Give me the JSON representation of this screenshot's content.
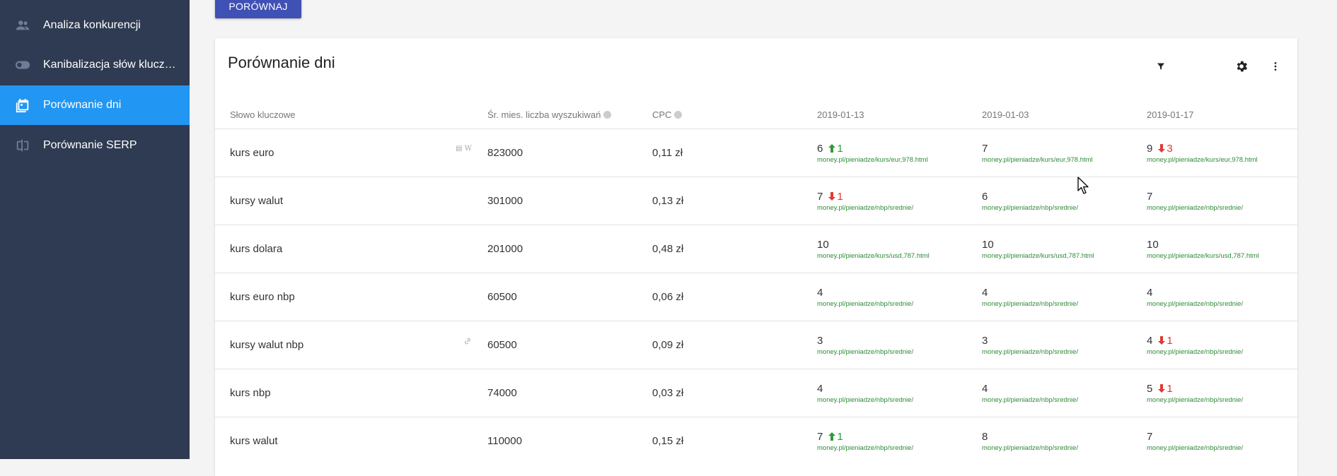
{
  "sidebar": {
    "items": [
      {
        "label": "Analiza konkurencji",
        "icon": "people-icon",
        "active": false
      },
      {
        "label": "Kanibalizacja słów klucz…",
        "icon": "toggle-icon",
        "active": false
      },
      {
        "label": "Porównanie dni",
        "icon": "calendar-compare-icon",
        "active": true
      },
      {
        "label": "Porównanie SERP",
        "icon": "compare-icon",
        "active": false
      }
    ]
  },
  "toolbar": {
    "compare_label": "PORÓWNAJ"
  },
  "card": {
    "title": "Porównanie dni",
    "headers": {
      "keyword": "Słowo kluczowe",
      "volume": "Śr. mies. liczba wyszukiwań",
      "cpc": "CPC",
      "date1": "2019-01-13",
      "date2": "2019-01-03",
      "date3": "2019-01-17"
    },
    "rows": [
      {
        "keyword": "kurs euro",
        "extra": "serp-features-icon",
        "volume": "823000",
        "cpc": "0,11 zł",
        "d1": {
          "pos": "6",
          "chg": "1",
          "dir": "up",
          "url": "money.pl/pieniadze/kurs/eur,978.html"
        },
        "d2": {
          "pos": "7",
          "chg": "",
          "dir": "",
          "url": "money.pl/pieniadze/kurs/eur,978.html"
        },
        "d3": {
          "pos": "9",
          "chg": "3",
          "dir": "down",
          "url": "money.pl/pieniadze/kurs/eur,978.html"
        }
      },
      {
        "keyword": "kursy walut",
        "extra": "",
        "volume": "301000",
        "cpc": "0,13 zł",
        "d1": {
          "pos": "7",
          "chg": "1",
          "dir": "down",
          "url": "money.pl/pieniadze/nbp/srednie/"
        },
        "d2": {
          "pos": "6",
          "chg": "",
          "dir": "",
          "url": "money.pl/pieniadze/nbp/srednie/"
        },
        "d3": {
          "pos": "7",
          "chg": "",
          "dir": "",
          "url": "money.pl/pieniadze/nbp/srednie/"
        }
      },
      {
        "keyword": "kurs dolara",
        "extra": "",
        "volume": "201000",
        "cpc": "0,48 zł",
        "d1": {
          "pos": "10",
          "chg": "",
          "dir": "",
          "url": "money.pl/pieniadze/kurs/usd,787.html"
        },
        "d2": {
          "pos": "10",
          "chg": "",
          "dir": "",
          "url": "money.pl/pieniadze/kurs/usd,787.html"
        },
        "d3": {
          "pos": "10",
          "chg": "",
          "dir": "",
          "url": "money.pl/pieniadze/kurs/usd,787.html"
        }
      },
      {
        "keyword": "kurs euro nbp",
        "extra": "",
        "volume": "60500",
        "cpc": "0,06 zł",
        "d1": {
          "pos": "4",
          "chg": "",
          "dir": "",
          "url": "money.pl/pieniadze/nbp/srednie/"
        },
        "d2": {
          "pos": "4",
          "chg": "",
          "dir": "",
          "url": "money.pl/pieniadze/nbp/srednie/"
        },
        "d3": {
          "pos": "4",
          "chg": "",
          "dir": "",
          "url": "money.pl/pieniadze/nbp/srednie/"
        }
      },
      {
        "keyword": "kursy walut nbp",
        "extra": "link-icon",
        "volume": "60500",
        "cpc": "0,09 zł",
        "d1": {
          "pos": "3",
          "chg": "",
          "dir": "",
          "url": "money.pl/pieniadze/nbp/srednie/"
        },
        "d2": {
          "pos": "3",
          "chg": "",
          "dir": "",
          "url": "money.pl/pieniadze/nbp/srednie/"
        },
        "d3": {
          "pos": "4",
          "chg": "1",
          "dir": "down",
          "url": "money.pl/pieniadze/nbp/srednie/"
        }
      },
      {
        "keyword": "kurs nbp",
        "extra": "",
        "volume": "74000",
        "cpc": "0,03 zł",
        "d1": {
          "pos": "4",
          "chg": "",
          "dir": "",
          "url": "money.pl/pieniadze/nbp/srednie/"
        },
        "d2": {
          "pos": "4",
          "chg": "",
          "dir": "",
          "url": "money.pl/pieniadze/nbp/srednie/"
        },
        "d3": {
          "pos": "5",
          "chg": "1",
          "dir": "down",
          "url": "money.pl/pieniadze/nbp/srednie/"
        }
      },
      {
        "keyword": "kurs walut",
        "extra": "",
        "volume": "110000",
        "cpc": "0,15 zł",
        "d1": {
          "pos": "7",
          "chg": "1",
          "dir": "up",
          "url": "money.pl/pieniadze/nbp/srednie/"
        },
        "d2": {
          "pos": "8",
          "chg": "",
          "dir": "",
          "url": "money.pl/pieniadze/nbp/srednie/"
        },
        "d3": {
          "pos": "7",
          "chg": "",
          "dir": "",
          "url": "money.pl/pieniadze/nbp/srednie/"
        }
      }
    ]
  },
  "colors": {
    "sidebar": "#2f3b52",
    "active": "#2196f3",
    "button": "#3f51b5",
    "up": "#2e9b3a",
    "down": "#e53935",
    "url": "#2e8b34"
  }
}
